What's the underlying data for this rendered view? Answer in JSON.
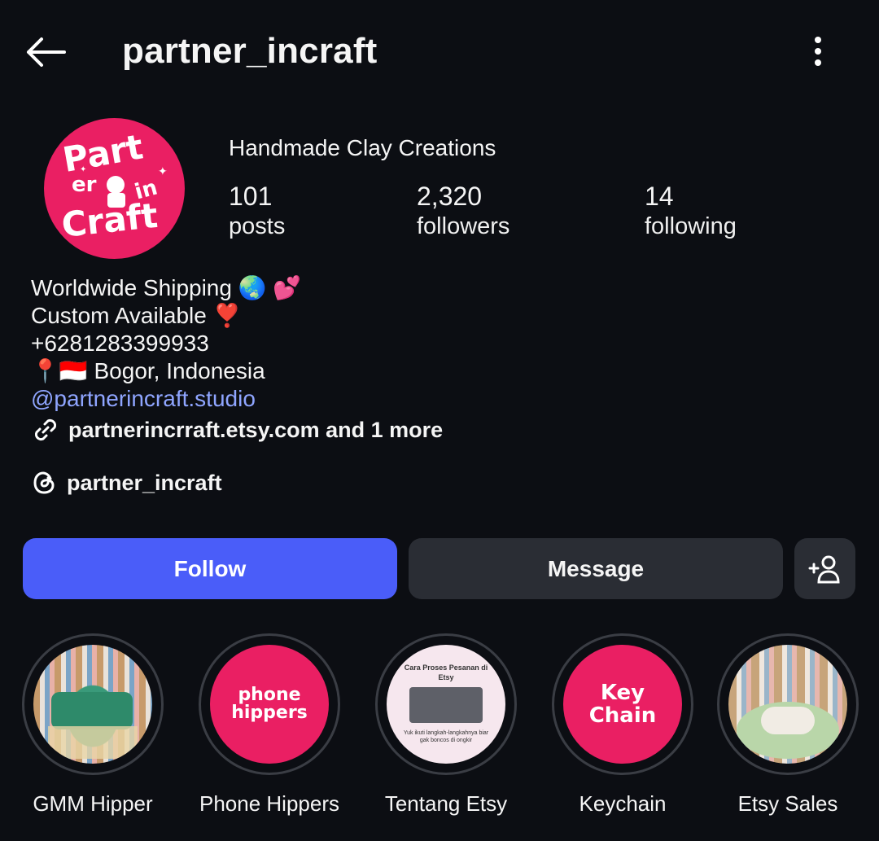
{
  "header": {
    "username": "partner_incraft"
  },
  "profile": {
    "display_name": "Handmade Clay Creations",
    "avatar_text": [
      "Part",
      "er",
      "in",
      "Craft"
    ],
    "stats": [
      {
        "value": "101",
        "label": "posts"
      },
      {
        "value": "2,320",
        "label": "followers"
      },
      {
        "value": "14",
        "label": "following"
      }
    ]
  },
  "bio": {
    "line1": "Worldwide Shipping 🌏 💕",
    "line2": "Custom Available ❣️",
    "line3": "+6281283399933",
    "line4": "📍🇮🇩 Bogor, Indonesia",
    "mention": "@partnerincraft.studio",
    "link_text": "partnerincrraft.etsy.com and 1 more",
    "threads_handle": "partner_incraft"
  },
  "actions": {
    "follow_label": "Follow",
    "message_label": "Message"
  },
  "highlights": [
    {
      "label": "GMM Hipper",
      "cover": "photo"
    },
    {
      "label": "Phone Hippers",
      "cover_text": "phone hippers"
    },
    {
      "label": "Tentang Etsy",
      "cover_title": "Cara Proses Pesanan di Etsy",
      "cover_caption": "Yuk ikuti langkah-langkahnya biar gak boncos di ongkir"
    },
    {
      "label": "Keychain",
      "cover_text": "Key Chain"
    },
    {
      "label": "Etsy Sales",
      "cover": "photo"
    }
  ],
  "colors": {
    "background": "#0c0e13",
    "brand_pink": "#ea1f63",
    "follow_blue": "#4a5df9",
    "mention_blue": "#8fa5ff",
    "secondary_button": "#2a2d34"
  }
}
